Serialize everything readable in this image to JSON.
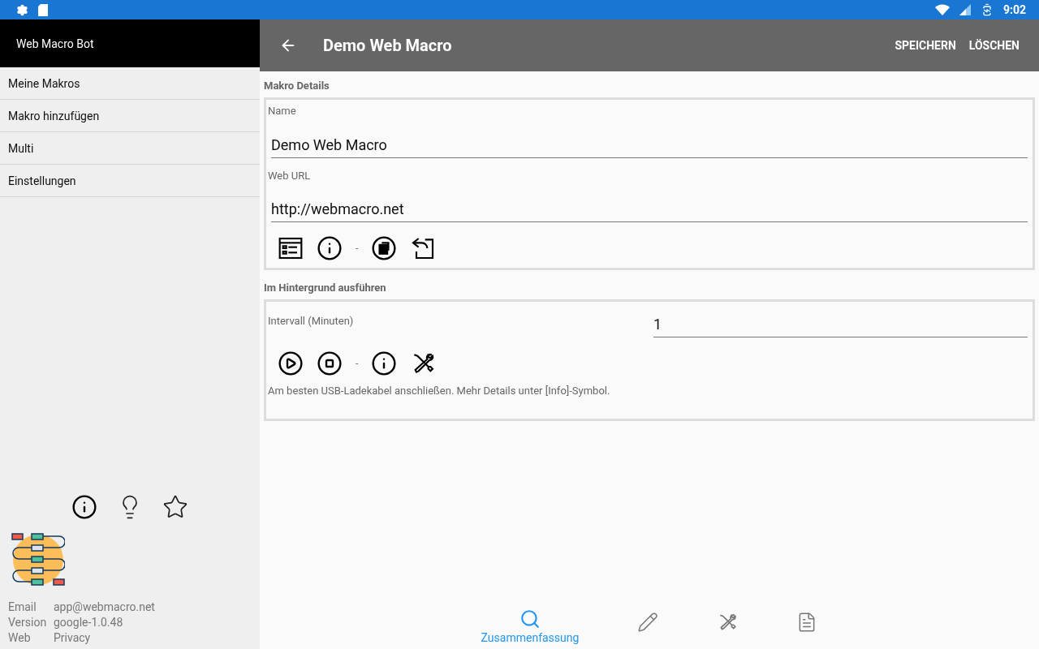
{
  "status_bar": {
    "time": "9:02"
  },
  "drawer": {
    "title": "Web Macro Bot",
    "items": [
      {
        "label": "Meine Makros"
      },
      {
        "label": "Makro hinzufügen"
      },
      {
        "label": "Multi"
      },
      {
        "label": "Einstellungen"
      }
    ],
    "footer_icons": [
      {
        "kind": "info"
      },
      {
        "kind": "bulb"
      },
      {
        "kind": "star"
      }
    ],
    "info": [
      {
        "key": "Email",
        "value": "app@webmacro.net"
      },
      {
        "key": "Version",
        "value": "google-1.0.48"
      },
      {
        "key": "Web",
        "value": "Privacy"
      }
    ]
  },
  "toolbar": {
    "title": "Demo Web Macro",
    "actions": [
      "SPEICHERN",
      "LÖSCHEN"
    ]
  },
  "details": {
    "heading": "Makro Details",
    "fields": [
      {
        "label": "Name",
        "value": "Demo Web Macro"
      },
      {
        "label": "Web URL",
        "value": "http://webmacro.net"
      }
    ],
    "tools": [
      {
        "kind": "browser"
      },
      {
        "kind": "info"
      },
      {
        "kind": "separator",
        "text": "-"
      },
      {
        "kind": "copy"
      },
      {
        "kind": "reply"
      }
    ]
  },
  "background": {
    "heading": "Im Hintergrund ausführen",
    "interval_label": "Intervall (Minuten)",
    "interval_value": "1",
    "tools": [
      {
        "kind": "play"
      },
      {
        "kind": "stop"
      },
      {
        "kind": "separator",
        "text": "-"
      },
      {
        "kind": "info"
      },
      {
        "kind": "tools"
      }
    ],
    "note": "Am besten USB-Ladekabel anschließen. Mehr Details unter [Info]-Symbol."
  },
  "bottom_nav": [
    {
      "kind": "search",
      "label": "Zusammenfassung",
      "selected": true
    },
    {
      "kind": "edit",
      "selected": false
    },
    {
      "kind": "tools",
      "selected": false
    },
    {
      "kind": "document",
      "selected": false
    }
  ]
}
